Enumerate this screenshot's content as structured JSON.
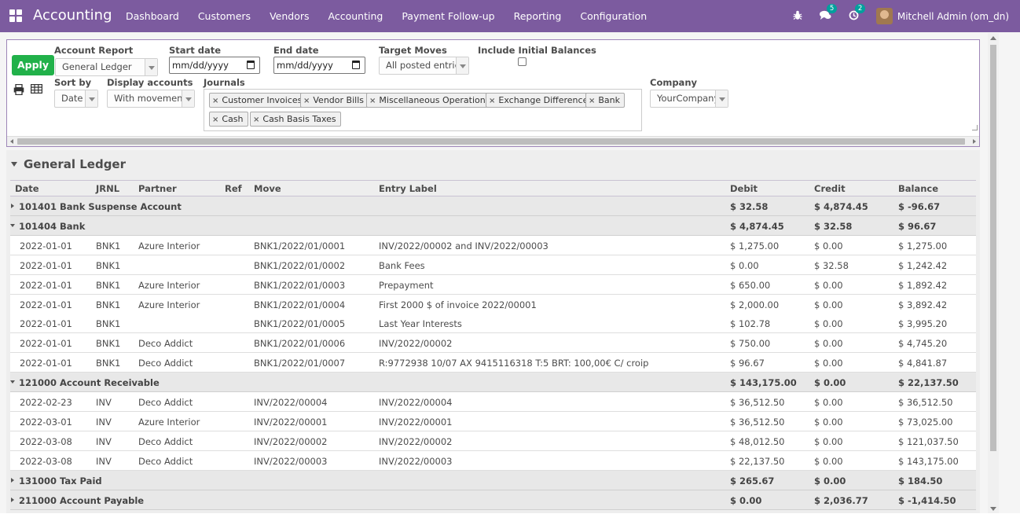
{
  "navbar": {
    "app_title": "Accounting",
    "menu": [
      "Dashboard",
      "Customers",
      "Vendors",
      "Accounting",
      "Payment Follow-up",
      "Reporting",
      "Configuration"
    ],
    "messages_badge": "5",
    "activities_badge": "2",
    "user_name": "Mitchell Admin (om_dn)",
    "color": "#7c5b9f"
  },
  "filters": {
    "apply_label": "Apply",
    "account_report_label": "Account Report",
    "account_report_value": "General Ledger",
    "start_date_label": "Start date",
    "start_date_value": "mm/dd/yyyy",
    "end_date_label": "End date",
    "end_date_value": "mm/dd/yyyy",
    "target_moves_label": "Target Moves",
    "target_moves_value": "All posted entries",
    "initial_balances_label": "Include Initial Balances",
    "sort_by_label": "Sort by",
    "sort_by_value": "Date",
    "display_accounts_label": "Display accounts",
    "display_accounts_value": "With movements",
    "journals_label": "Journals",
    "journals": [
      "Customer Invoices",
      "Vendor Bills",
      "Miscellaneous Operations",
      "Exchange Difference",
      "Bank",
      "Cash",
      "Cash Basis Taxes"
    ],
    "company_label": "Company",
    "company_value": "YourCompany"
  },
  "report": {
    "title": "General Ledger",
    "columns": [
      "Date",
      "JRNL",
      "Partner",
      "Ref",
      "Move",
      "Entry Label",
      "Debit",
      "Credit",
      "Balance"
    ],
    "rows": [
      {
        "type": "account",
        "expanded": false,
        "name": "101401 Bank Suspense Account",
        "debit": "$ 32.58",
        "credit": "$ 4,874.45",
        "balance": "$ -96.67"
      },
      {
        "type": "account",
        "expanded": true,
        "name": "101404 Bank",
        "debit": "$ 4,874.45",
        "credit": "$ 32.58",
        "balance": "$ 96.67"
      },
      {
        "type": "line",
        "date": "2022-01-01",
        "jrnl": "BNK1",
        "partner": "Azure Interior",
        "ref": "",
        "move": "BNK1/2022/01/0001",
        "label": "INV/2022/00002 and INV/2022/00003",
        "debit": "$ 1,275.00",
        "credit": "$ 0.00",
        "balance": "$ 1,275.00"
      },
      {
        "type": "line",
        "date": "2022-01-01",
        "jrnl": "BNK1",
        "partner": "",
        "ref": "",
        "move": "BNK1/2022/01/0002",
        "label": "Bank Fees",
        "debit": "$ 0.00",
        "credit": "$ 32.58",
        "balance": "$ 1,242.42"
      },
      {
        "type": "line",
        "date": "2022-01-01",
        "jrnl": "BNK1",
        "partner": "Azure Interior",
        "ref": "",
        "move": "BNK1/2022/01/0003",
        "label": "Prepayment",
        "debit": "$ 650.00",
        "credit": "$ 0.00",
        "balance": "$ 1,892.42"
      },
      {
        "type": "line",
        "date": "2022-01-01",
        "jrnl": "BNK1",
        "partner": "Azure Interior",
        "ref": "",
        "move": "BNK1/2022/01/0004",
        "label": "First 2000 $ of invoice 2022/00001",
        "debit": "$ 2,000.00",
        "credit": "$ 0.00",
        "balance": "$ 3,892.42"
      },
      {
        "type": "line",
        "date": "2022-01-01",
        "jrnl": "BNK1",
        "partner": "",
        "ref": "",
        "move": "BNK1/2022/01/0005",
        "label": "Last Year Interests",
        "debit": "$ 102.78",
        "credit": "$ 0.00",
        "balance": "$ 3,995.20"
      },
      {
        "type": "line",
        "date": "2022-01-01",
        "jrnl": "BNK1",
        "partner": "Deco Addict",
        "ref": "",
        "move": "BNK1/2022/01/0006",
        "label": "INV/2022/00002",
        "debit": "$ 750.00",
        "credit": "$ 0.00",
        "balance": "$ 4,745.20"
      },
      {
        "type": "line",
        "date": "2022-01-01",
        "jrnl": "BNK1",
        "partner": "Deco Addict",
        "ref": "",
        "move": "BNK1/2022/01/0007",
        "label": "R:9772938 10/07 AX 9415116318 T:5 BRT: 100,00€ C/ croip",
        "debit": "$ 96.67",
        "credit": "$ 0.00",
        "balance": "$ 4,841.87"
      },
      {
        "type": "account",
        "expanded": true,
        "name": "121000 Account Receivable",
        "debit": "$ 143,175.00",
        "credit": "$ 0.00",
        "balance": "$ 22,137.50"
      },
      {
        "type": "line",
        "date": "2022-02-23",
        "jrnl": "INV",
        "partner": "Deco Addict",
        "ref": "",
        "move": "INV/2022/00004",
        "label": "INV/2022/00004",
        "debit": "$ 36,512.50",
        "credit": "$ 0.00",
        "balance": "$ 36,512.50"
      },
      {
        "type": "line",
        "date": "2022-03-01",
        "jrnl": "INV",
        "partner": "Azure Interior",
        "ref": "",
        "move": "INV/2022/00001",
        "label": "INV/2022/00001",
        "debit": "$ 36,512.50",
        "credit": "$ 0.00",
        "balance": "$ 73,025.00"
      },
      {
        "type": "line",
        "date": "2022-03-08",
        "jrnl": "INV",
        "partner": "Deco Addict",
        "ref": "",
        "move": "INV/2022/00002",
        "label": "INV/2022/00002",
        "debit": "$ 48,012.50",
        "credit": "$ 0.00",
        "balance": "$ 121,037.50"
      },
      {
        "type": "line",
        "date": "2022-03-08",
        "jrnl": "INV",
        "partner": "Deco Addict",
        "ref": "",
        "move": "INV/2022/00003",
        "label": "INV/2022/00003",
        "debit": "$ 22,137.50",
        "credit": "$ 0.00",
        "balance": "$ 143,175.00"
      },
      {
        "type": "account",
        "expanded": false,
        "name": "131000 Tax Paid",
        "debit": "$ 265.67",
        "credit": "$ 0.00",
        "balance": "$ 184.50"
      },
      {
        "type": "account",
        "expanded": false,
        "name": "211000 Account Payable",
        "debit": "$ 0.00",
        "credit": "$ 2,036.77",
        "balance": "$ -1,414.50"
      }
    ]
  }
}
